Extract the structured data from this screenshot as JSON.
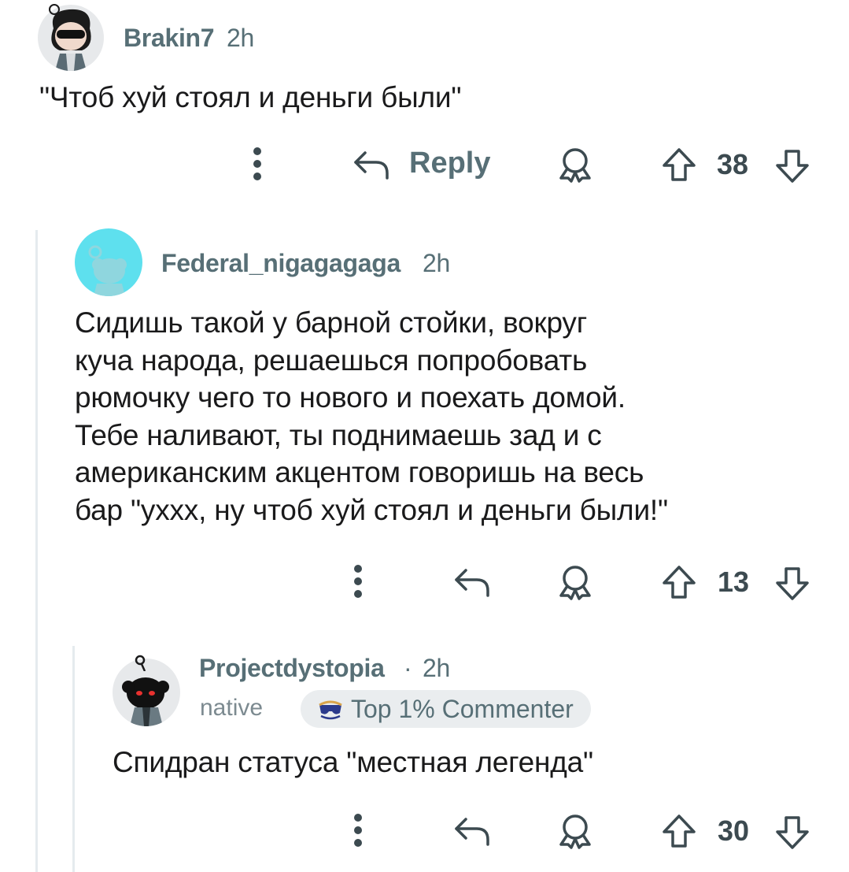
{
  "comments": [
    {
      "username": "Brakin7",
      "time": "2h",
      "text": "\"Чтоб хуй стоял и деньги были\"",
      "reply_label": "Reply",
      "score": "38"
    },
    {
      "username": "Federal_nigagagaga",
      "time": "2h",
      "lines": [
        "Сидишь такой у барной стойки, вокруг",
        "куча народа, решаешься попробовать",
        "рюмочку чего то нового и поехать домой.",
        "Тебе наливают, ты поднимаешь зад и с",
        "американским акцентом говоришь на весь",
        "бар \"ухxx, ну чтоб хуй стоял и деньги были!\""
      ],
      "score": "13"
    },
    {
      "username": "Projectdystopia",
      "separator": "·",
      "time": "2h",
      "subtitle": "native",
      "flair": "Top 1% Commenter",
      "text": "Спидран статуса \"местная легенда\"",
      "score": "30"
    }
  ],
  "icons": {
    "more": "more-vertical-icon",
    "reply": "reply-arrow-icon",
    "award": "award-icon",
    "upvote": "upvote-arrow-icon",
    "downvote": "downvote-arrow-icon",
    "flair": "sunglasses-icon"
  },
  "colors": {
    "meta_text": "#576f76",
    "body_text": "#1a1a1b",
    "thread_line": "#e5ebee",
    "flair_bg": "#eaedef",
    "avatar2_bg": "#5ee0ee"
  }
}
